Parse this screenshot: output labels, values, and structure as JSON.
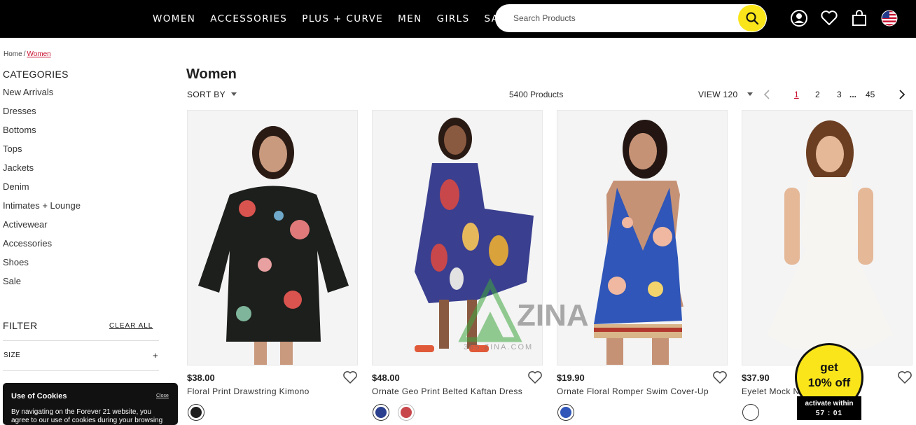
{
  "header": {
    "nav": [
      "WOMEN",
      "ACCESSORIES",
      "PLUS + CURVE",
      "MEN",
      "GIRLS",
      "SALE"
    ],
    "search_placeholder": "Search Products",
    "icons": [
      "account-icon",
      "wishlist-heart-icon",
      "shopping-bag-icon",
      "us-flag-icon"
    ]
  },
  "breadcrumb": {
    "home": "Home",
    "sep": "/",
    "current": "Women"
  },
  "sidebar": {
    "categories_title": "CATEGORIES",
    "categories": [
      "New Arrivals",
      "Dresses",
      "Bottoms",
      "Tops",
      "Jackets",
      "Denim",
      "Intimates + Lounge",
      "Activewear",
      "Accessories",
      "Shoes",
      "Sale"
    ],
    "filter_title": "FILTER",
    "clear_all": "CLEAR ALL",
    "size_label": "SIZE",
    "size_toggle": "+"
  },
  "main": {
    "title": "Women",
    "sort_label": "SORT BY",
    "product_count": "5400 Products",
    "view_label": "VIEW 120",
    "pages": [
      "1",
      "2",
      "3",
      "...",
      "45"
    ],
    "current_page": "1"
  },
  "products": [
    {
      "price": "$38.00",
      "name": "Floral Print Drawstring Kimono",
      "swatch_colors": [
        "#1d1d1d"
      ]
    },
    {
      "price": "$48.00",
      "name": "Ornate Geo Print Belted Kaftan Dress",
      "swatch_colors": [
        "#2b3f8f",
        "#c8474b"
      ]
    },
    {
      "price": "$19.90",
      "name": "Ornate Floral Romper Swim Cover-Up",
      "swatch_colors": [
        "#2f56b8"
      ]
    },
    {
      "price": "$37.90",
      "name": "Eyelet Mock N",
      "swatch_colors": [
        "#ffffff"
      ]
    }
  ],
  "watermark": {
    "brand": "ZINA",
    "url": "365 ZINA.COM"
  },
  "promo": {
    "line1": "get",
    "line2": "10% off",
    "timer_label": "activate within",
    "timer_value": "57 : 01"
  },
  "cookie": {
    "title": "Use of Cookies",
    "close": "Close",
    "body": "By navigating on the Forever 21 website, you agree to our use of cookies during your browsing"
  },
  "colors": {
    "topbar": "#000000",
    "accent_yellow": "#f9e51a",
    "link_red": "#c8102e"
  }
}
